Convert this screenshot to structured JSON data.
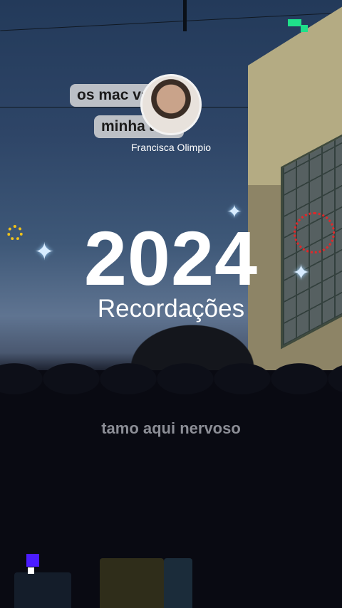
{
  "story": {
    "comment_line1": "os mac   vadiu",
    "comment_line2": "minha   a",
    "comment_emoji": "🥰",
    "username": "Francisca Olimpio",
    "year": "2024",
    "subtitle": "Recordações",
    "caption": "tamo aqui nervoso"
  },
  "icons": {
    "sparkle": "✦",
    "star": "✧"
  },
  "colors": {
    "accent_green": "#1fe08a",
    "sun_yellow": "#f0c21a",
    "dot_red": "#e0282a",
    "badge_purple": "#4b1cff"
  }
}
